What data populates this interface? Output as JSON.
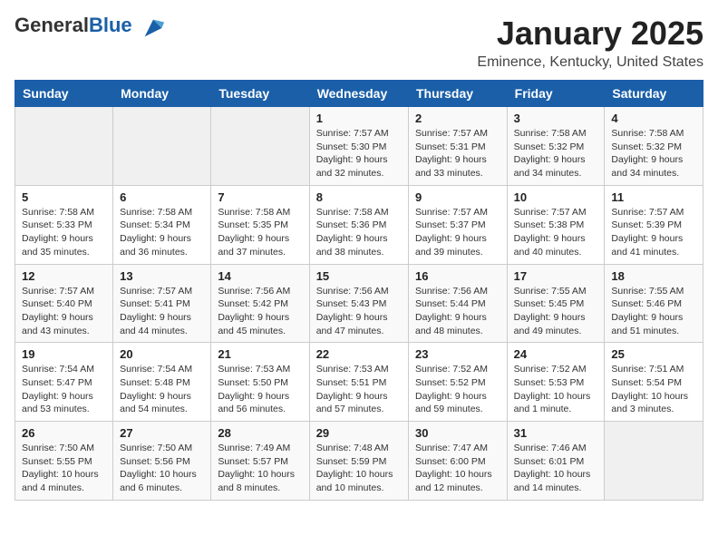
{
  "header": {
    "logo_general": "General",
    "logo_blue": "Blue",
    "month_title": "January 2025",
    "subtitle": "Eminence, Kentucky, United States"
  },
  "days_of_week": [
    "Sunday",
    "Monday",
    "Tuesday",
    "Wednesday",
    "Thursday",
    "Friday",
    "Saturday"
  ],
  "weeks": [
    [
      {
        "day": "",
        "info": ""
      },
      {
        "day": "",
        "info": ""
      },
      {
        "day": "",
        "info": ""
      },
      {
        "day": "1",
        "info": "Sunrise: 7:57 AM\nSunset: 5:30 PM\nDaylight: 9 hours and 32 minutes."
      },
      {
        "day": "2",
        "info": "Sunrise: 7:57 AM\nSunset: 5:31 PM\nDaylight: 9 hours and 33 minutes."
      },
      {
        "day": "3",
        "info": "Sunrise: 7:58 AM\nSunset: 5:32 PM\nDaylight: 9 hours and 34 minutes."
      },
      {
        "day": "4",
        "info": "Sunrise: 7:58 AM\nSunset: 5:32 PM\nDaylight: 9 hours and 34 minutes."
      }
    ],
    [
      {
        "day": "5",
        "info": "Sunrise: 7:58 AM\nSunset: 5:33 PM\nDaylight: 9 hours and 35 minutes."
      },
      {
        "day": "6",
        "info": "Sunrise: 7:58 AM\nSunset: 5:34 PM\nDaylight: 9 hours and 36 minutes."
      },
      {
        "day": "7",
        "info": "Sunrise: 7:58 AM\nSunset: 5:35 PM\nDaylight: 9 hours and 37 minutes."
      },
      {
        "day": "8",
        "info": "Sunrise: 7:58 AM\nSunset: 5:36 PM\nDaylight: 9 hours and 38 minutes."
      },
      {
        "day": "9",
        "info": "Sunrise: 7:57 AM\nSunset: 5:37 PM\nDaylight: 9 hours and 39 minutes."
      },
      {
        "day": "10",
        "info": "Sunrise: 7:57 AM\nSunset: 5:38 PM\nDaylight: 9 hours and 40 minutes."
      },
      {
        "day": "11",
        "info": "Sunrise: 7:57 AM\nSunset: 5:39 PM\nDaylight: 9 hours and 41 minutes."
      }
    ],
    [
      {
        "day": "12",
        "info": "Sunrise: 7:57 AM\nSunset: 5:40 PM\nDaylight: 9 hours and 43 minutes."
      },
      {
        "day": "13",
        "info": "Sunrise: 7:57 AM\nSunset: 5:41 PM\nDaylight: 9 hours and 44 minutes."
      },
      {
        "day": "14",
        "info": "Sunrise: 7:56 AM\nSunset: 5:42 PM\nDaylight: 9 hours and 45 minutes."
      },
      {
        "day": "15",
        "info": "Sunrise: 7:56 AM\nSunset: 5:43 PM\nDaylight: 9 hours and 47 minutes."
      },
      {
        "day": "16",
        "info": "Sunrise: 7:56 AM\nSunset: 5:44 PM\nDaylight: 9 hours and 48 minutes."
      },
      {
        "day": "17",
        "info": "Sunrise: 7:55 AM\nSunset: 5:45 PM\nDaylight: 9 hours and 49 minutes."
      },
      {
        "day": "18",
        "info": "Sunrise: 7:55 AM\nSunset: 5:46 PM\nDaylight: 9 hours and 51 minutes."
      }
    ],
    [
      {
        "day": "19",
        "info": "Sunrise: 7:54 AM\nSunset: 5:47 PM\nDaylight: 9 hours and 53 minutes."
      },
      {
        "day": "20",
        "info": "Sunrise: 7:54 AM\nSunset: 5:48 PM\nDaylight: 9 hours and 54 minutes."
      },
      {
        "day": "21",
        "info": "Sunrise: 7:53 AM\nSunset: 5:50 PM\nDaylight: 9 hours and 56 minutes."
      },
      {
        "day": "22",
        "info": "Sunrise: 7:53 AM\nSunset: 5:51 PM\nDaylight: 9 hours and 57 minutes."
      },
      {
        "day": "23",
        "info": "Sunrise: 7:52 AM\nSunset: 5:52 PM\nDaylight: 9 hours and 59 minutes."
      },
      {
        "day": "24",
        "info": "Sunrise: 7:52 AM\nSunset: 5:53 PM\nDaylight: 10 hours and 1 minute."
      },
      {
        "day": "25",
        "info": "Sunrise: 7:51 AM\nSunset: 5:54 PM\nDaylight: 10 hours and 3 minutes."
      }
    ],
    [
      {
        "day": "26",
        "info": "Sunrise: 7:50 AM\nSunset: 5:55 PM\nDaylight: 10 hours and 4 minutes."
      },
      {
        "day": "27",
        "info": "Sunrise: 7:50 AM\nSunset: 5:56 PM\nDaylight: 10 hours and 6 minutes."
      },
      {
        "day": "28",
        "info": "Sunrise: 7:49 AM\nSunset: 5:57 PM\nDaylight: 10 hours and 8 minutes."
      },
      {
        "day": "29",
        "info": "Sunrise: 7:48 AM\nSunset: 5:59 PM\nDaylight: 10 hours and 10 minutes."
      },
      {
        "day": "30",
        "info": "Sunrise: 7:47 AM\nSunset: 6:00 PM\nDaylight: 10 hours and 12 minutes."
      },
      {
        "day": "31",
        "info": "Sunrise: 7:46 AM\nSunset: 6:01 PM\nDaylight: 10 hours and 14 minutes."
      },
      {
        "day": "",
        "info": ""
      }
    ]
  ]
}
